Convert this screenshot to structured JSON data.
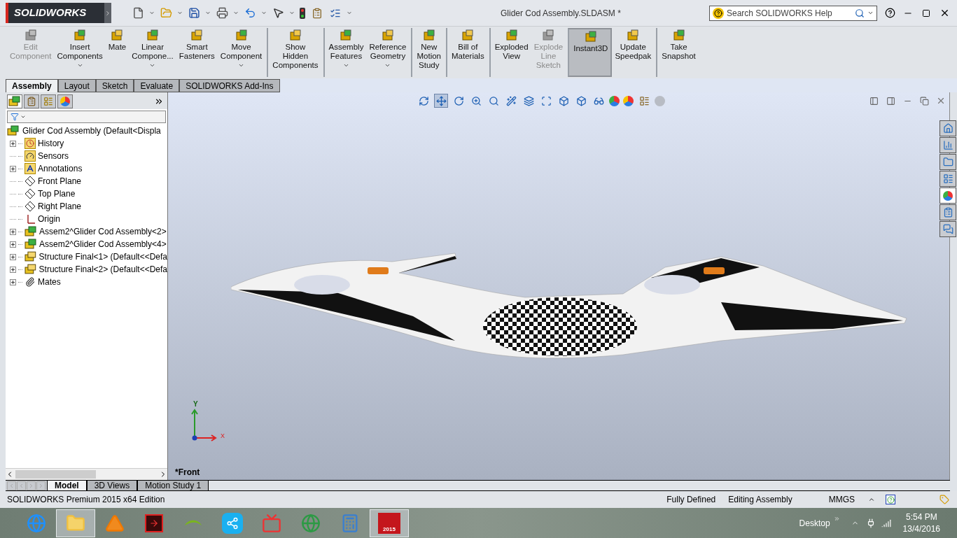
{
  "app": {
    "logo": "SOLIDWORKS",
    "title": "Glider Cod Assembly.SLDASM *",
    "help_search": {
      "placeholder": "Search SOLIDWORKS Help"
    }
  },
  "ribbon": [
    {
      "lines": [
        "Edit",
        "Component"
      ],
      "disabled": true,
      "dropdown": false,
      "selected": false,
      "group_start": false
    },
    {
      "lines": [
        "Insert",
        "Components"
      ],
      "disabled": false,
      "dropdown": true,
      "selected": false,
      "group_start": false
    },
    {
      "lines": [
        "Mate"
      ],
      "disabled": false,
      "dropdown": false,
      "selected": false,
      "group_start": false
    },
    {
      "lines": [
        "Linear",
        "Compone..."
      ],
      "disabled": false,
      "dropdown": true,
      "selected": false,
      "group_start": false
    },
    {
      "lines": [
        "Smart",
        "Fasteners"
      ],
      "disabled": false,
      "dropdown": false,
      "selected": false,
      "group_start": false
    },
    {
      "lines": [
        "Move",
        "Component"
      ],
      "disabled": false,
      "dropdown": true,
      "selected": false,
      "group_start": false
    },
    {
      "lines": [
        "Show",
        "Hidden",
        "Components"
      ],
      "disabled": false,
      "dropdown": false,
      "selected": false,
      "group_start": true
    },
    {
      "lines": [
        "Assembly",
        "Features"
      ],
      "disabled": false,
      "dropdown": true,
      "selected": false,
      "group_start": true
    },
    {
      "lines": [
        "Reference",
        "Geometry"
      ],
      "disabled": false,
      "dropdown": true,
      "selected": false,
      "group_start": false
    },
    {
      "lines": [
        "New",
        "Motion",
        "Study"
      ],
      "disabled": false,
      "dropdown": false,
      "selected": false,
      "group_start": true
    },
    {
      "lines": [
        "Bill of",
        "Materials"
      ],
      "disabled": false,
      "dropdown": false,
      "selected": false,
      "group_start": true
    },
    {
      "lines": [
        "Exploded",
        "View"
      ],
      "disabled": false,
      "dropdown": false,
      "selected": false,
      "group_start": true
    },
    {
      "lines": [
        "Explode",
        "Line",
        "Sketch"
      ],
      "disabled": true,
      "dropdown": false,
      "selected": false,
      "group_start": false
    },
    {
      "lines": [
        "Instant3D"
      ],
      "disabled": false,
      "dropdown": false,
      "selected": true,
      "group_start": true
    },
    {
      "lines": [
        "Update",
        "Speedpak"
      ],
      "disabled": false,
      "dropdown": false,
      "selected": false,
      "group_start": false
    },
    {
      "lines": [
        "Take",
        "Snapshot"
      ],
      "disabled": false,
      "dropdown": false,
      "selected": false,
      "group_start": true
    }
  ],
  "command_tabs": [
    {
      "label": "Assembly",
      "selected": true
    },
    {
      "label": "Layout",
      "selected": false
    },
    {
      "label": "Sketch",
      "selected": false
    },
    {
      "label": "Evaluate",
      "selected": false
    },
    {
      "label": "SOLIDWORKS Add-Ins",
      "selected": false
    }
  ],
  "tree": {
    "root": "Glider Cod Assembly  (Default<Displa",
    "items": [
      {
        "label": "History",
        "kind": "history",
        "expandable": true
      },
      {
        "label": "Sensors",
        "kind": "sensors",
        "expandable": false
      },
      {
        "label": "Annotations",
        "kind": "annotations",
        "expandable": true
      },
      {
        "label": "Front Plane",
        "kind": "plane",
        "expandable": false
      },
      {
        "label": "Top Plane",
        "kind": "plane",
        "expandable": false
      },
      {
        "label": "Right Plane",
        "kind": "plane",
        "expandable": false
      },
      {
        "label": "Origin",
        "kind": "origin",
        "expandable": false
      },
      {
        "label": "Assem2^Glider Cod Assembly<2>",
        "kind": "assembly",
        "expandable": true
      },
      {
        "label": "Assem2^Glider Cod Assembly<4>",
        "kind": "assembly",
        "expandable": true
      },
      {
        "label": "Structure Final<1>  (Default<<Defa",
        "kind": "part",
        "expandable": true
      },
      {
        "label": "Structure Final<2>  (Default<<Defa",
        "kind": "part",
        "expandable": true
      },
      {
        "label": "Mates",
        "kind": "mates",
        "expandable": true
      }
    ]
  },
  "viewport": {
    "view_label": "*Front",
    "triad": {
      "x": "X",
      "y": "Y"
    }
  },
  "bottom_tabs": [
    {
      "label": "Model",
      "selected": true
    },
    {
      "label": "3D Views",
      "selected": false
    },
    {
      "label": "Motion Study 1",
      "selected": false
    }
  ],
  "status_bar": {
    "edition": "SOLIDWORKS Premium 2015 x64 Edition",
    "state": "Fully Defined",
    "mode": "Editing Assembly",
    "units": "MMGS"
  },
  "taskbar": {
    "apps": [
      {
        "running": false
      },
      {
        "running": true
      },
      {
        "running": false
      },
      {
        "running": false
      },
      {
        "running": false
      },
      {
        "running": false
      },
      {
        "running": false
      },
      {
        "running": false
      },
      {
        "running": false
      },
      {
        "running": true
      }
    ],
    "sw_badge": "2015",
    "desktop": "Desktop",
    "time": "5:54 PM",
    "date": "13/4/2016"
  }
}
